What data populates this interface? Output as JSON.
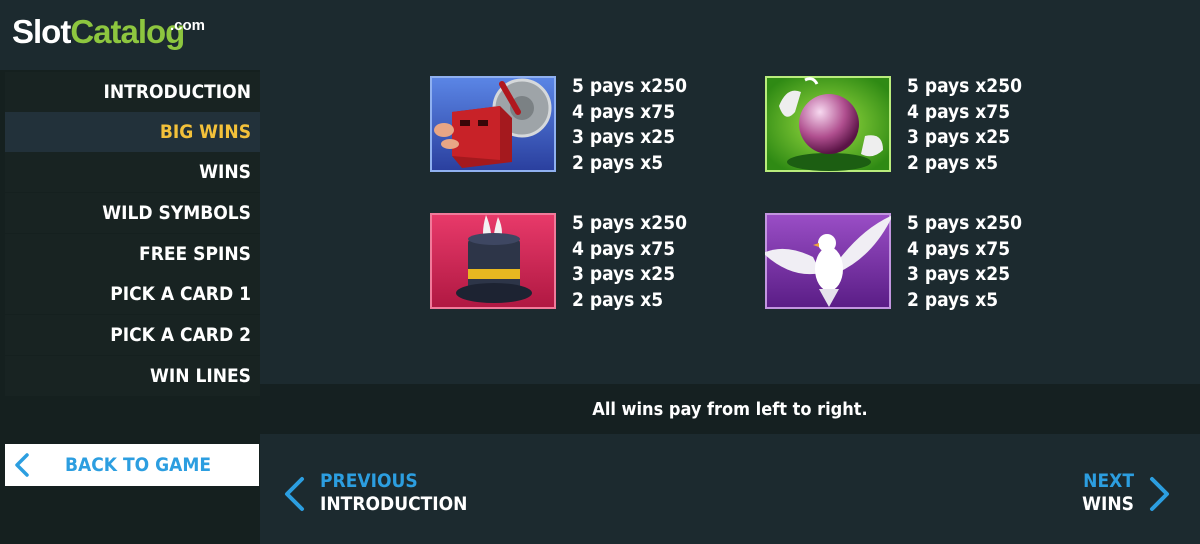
{
  "logo": {
    "part1": "Slot",
    "part2": "Catalog",
    "suffix": ".com"
  },
  "sidebar": {
    "items": [
      {
        "label": "INTRODUCTION",
        "active": false
      },
      {
        "label": "BIG WINS",
        "active": true
      },
      {
        "label": "WINS",
        "active": false
      },
      {
        "label": "WILD SYMBOLS",
        "active": false
      },
      {
        "label": "FREE SPINS",
        "active": false
      },
      {
        "label": "PICK A CARD 1",
        "active": false
      },
      {
        "label": "PICK A CARD 2",
        "active": false
      },
      {
        "label": "WIN LINES",
        "active": false
      }
    ],
    "back_label": "BACK TO GAME"
  },
  "symbols": [
    {
      "name": "magic-box-saw",
      "pays": [
        "5 pays x250",
        "4 pays x75",
        "3 pays x25",
        "2 pays x5"
      ]
    },
    {
      "name": "crystal-ball",
      "pays": [
        "5 pays x250",
        "4 pays x75",
        "3 pays x25",
        "2 pays x5"
      ]
    },
    {
      "name": "top-hat-rabbit",
      "pays": [
        "5 pays x250",
        "4 pays x75",
        "3 pays x25",
        "2 pays x5"
      ]
    },
    {
      "name": "white-dove",
      "pays": [
        "5 pays x250",
        "4 pays x75",
        "3 pays x25",
        "2 pays x5"
      ]
    }
  ],
  "info": {
    "text": "All wins pay from left to right."
  },
  "footer": {
    "prev": {
      "top": "PREVIOUS",
      "bottom": "INTRODUCTION"
    },
    "next": {
      "top": "NEXT",
      "bottom": "WINS"
    }
  },
  "colors": {
    "accent_blue": "#2c9ee0",
    "active_yellow": "#f3c13a",
    "logo_green": "#8dc63f"
  }
}
